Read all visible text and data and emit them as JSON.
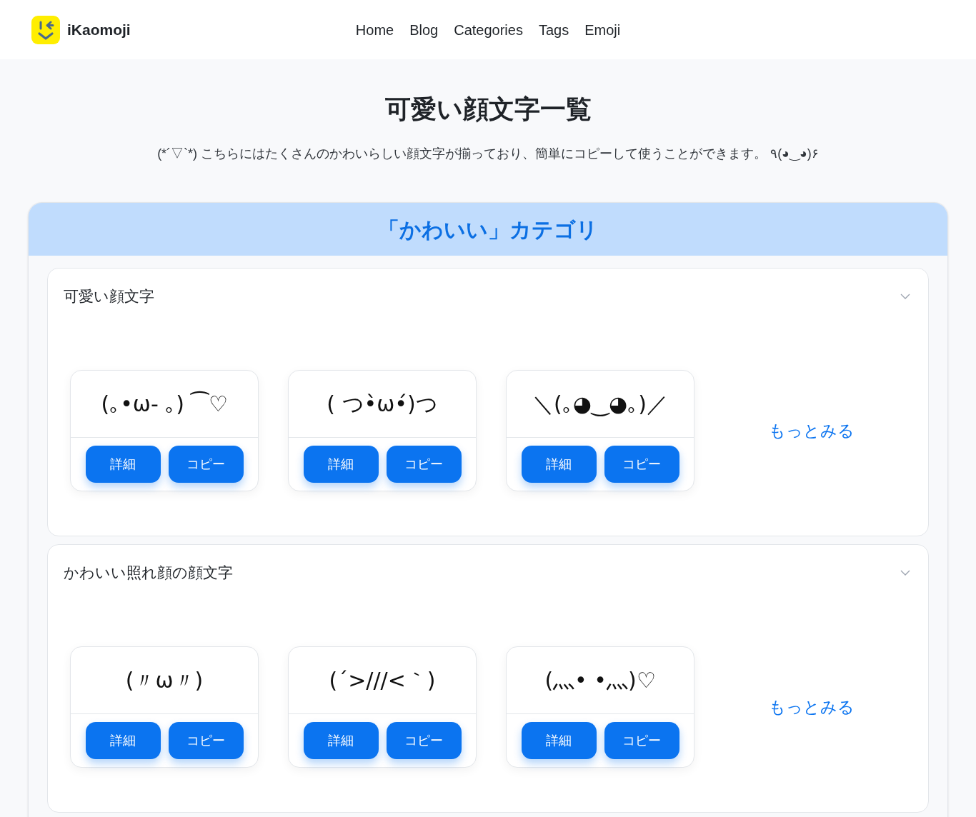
{
  "header": {
    "logo_text": "iKaomoji",
    "nav": [
      "Home",
      "Blog",
      "Categories",
      "Tags",
      "Emoji"
    ]
  },
  "hero": {
    "title": "可愛い顔文字一覧",
    "subtitle": "(*´▽`*) こちらにはたくさんのかわいらしい顔文字が揃っており、簡単にコピーして使うことができます。 ٩(◕‿◕)۶"
  },
  "category": {
    "title": "「かわいい」カテゴリ",
    "sections": [
      {
        "title": "可愛い顔文字",
        "expanded": true,
        "more_link": "もっとみる",
        "items": [
          {
            "face": "(｡•ω- ｡) ⁀♡",
            "buttons": [
              "詳細",
              "コピー"
            ]
          },
          {
            "face": "( つ•̀ω•́)つ",
            "buttons": [
              "詳細",
              "コピー"
            ]
          },
          {
            "face": "＼(｡◕‿◕｡)／",
            "buttons": [
              "詳細",
              "コピー"
            ]
          }
        ]
      },
      {
        "title": "かわいい照れ顔の顔文字",
        "expanded": true,
        "more_link": "もっとみる",
        "items": [
          {
            "face": "(〃ω〃)",
            "buttons": [
              "詳細",
              "コピー"
            ]
          },
          {
            "face": "(´>///<｀)",
            "buttons": [
              "詳細",
              "コピー"
            ]
          },
          {
            "face": "(灬• •灬)♡",
            "buttons": [
              "詳細",
              "コピー"
            ]
          }
        ]
      }
    ]
  }
}
